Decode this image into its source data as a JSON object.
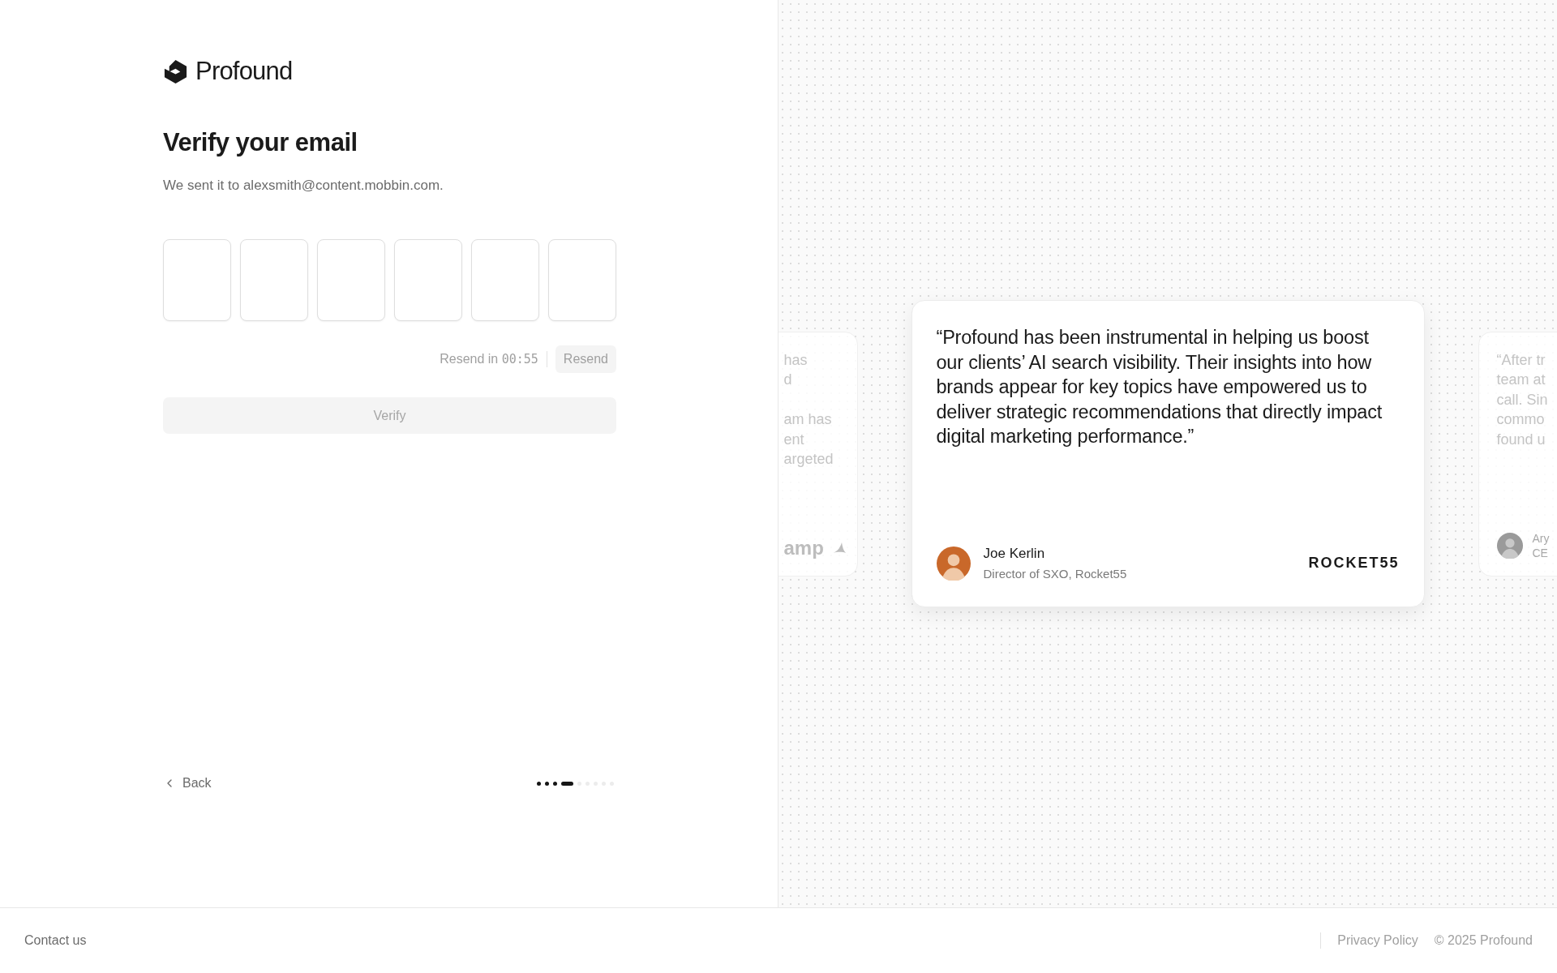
{
  "brand": {
    "name": "Profound"
  },
  "heading": "Verify your email",
  "subtitle": "We sent it to alexsmith@content.mobbin.com.",
  "code_fields": [
    {
      "filled": false
    },
    {
      "filled": false
    },
    {
      "filled": false
    },
    {
      "filled": false
    },
    {
      "filled": false
    },
    {
      "filled": false
    }
  ],
  "resend": {
    "countdown_label": "Resend in",
    "countdown": "00:55",
    "button": "Resend",
    "disabled": true
  },
  "verify_button": {
    "label": "Verify",
    "disabled": true
  },
  "back_link": "Back",
  "steps": [
    {
      "done": true,
      "selected": false
    },
    {
      "done": true,
      "selected": false
    },
    {
      "done": true,
      "selected": false
    },
    {
      "done": true,
      "selected": true
    },
    {
      "done": false,
      "selected": false
    },
    {
      "done": false,
      "selected": false
    },
    {
      "done": false,
      "selected": false
    },
    {
      "done": false,
      "selected": false
    },
    {
      "done": false,
      "selected": false
    }
  ],
  "testimonials": [
    {
      "kind": "partial-left",
      "paragraphs": [
        [
          "has",
          "d"
        ],
        [
          "am has",
          "ent",
          "argeted"
        ]
      ],
      "logo": "amp"
    },
    {
      "kind": "main",
      "quote": "“Profound has been instrumental in helping us boost our clients’ AI search visibility. Their insights into how brands appear for key topics have empowered us to deliver strategic recommendations that directly impact digital marketing performance.”",
      "name": "Joe Kerlin",
      "role": "Director of SXO, Rocket55",
      "logo": "ROCKET55"
    },
    {
      "kind": "partial-right",
      "lines": [
        "“After tr",
        "team at",
        "call. Sin",
        "commo",
        "found u"
      ],
      "name": "Ary",
      "role": "CE"
    }
  ],
  "footer": {
    "contact": "Contact us",
    "privacy": "Privacy Policy",
    "copyright": "© 2025 Profound"
  }
}
